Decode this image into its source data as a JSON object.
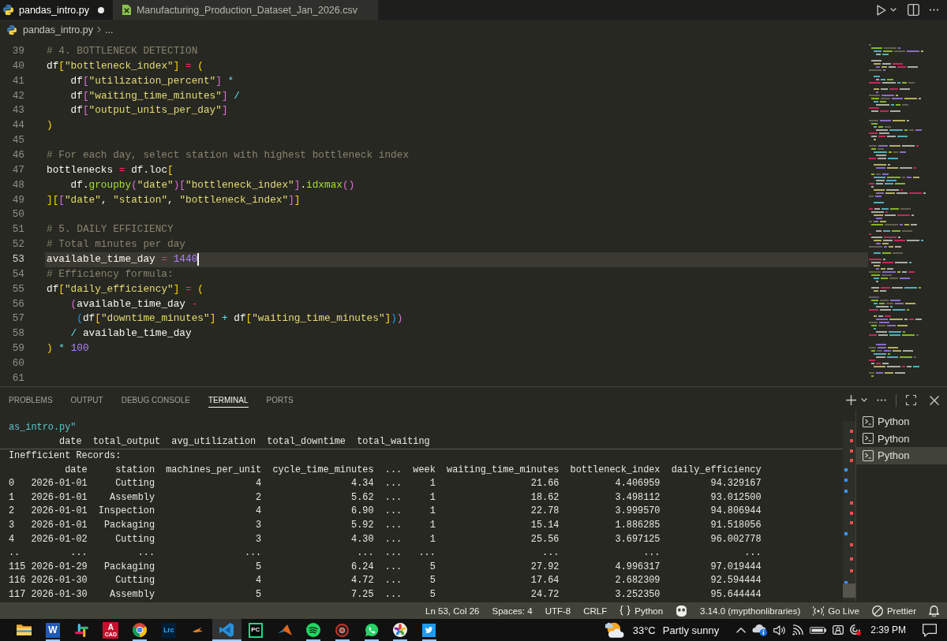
{
  "editor_tabs": [
    {
      "label": "pandas_intro.py",
      "kind": "python",
      "selected": true,
      "modified": true
    },
    {
      "label": "Manufacturing_Production_Dataset_Jan_2026.csv",
      "kind": "csv",
      "selected": false,
      "modified": false
    }
  ],
  "breadcrumb": {
    "file": "pandas_intro.py",
    "more": "..."
  },
  "code_lines": [
    {
      "number": "39",
      "active": false,
      "tokens": [
        {
          "kind": "comment",
          "text": "# 4. BOTTLENECK DETECTION"
        }
      ]
    },
    {
      "number": "40",
      "active": false,
      "tokens": [
        {
          "kind": "plain",
          "text": "df"
        },
        {
          "kind": "bracket1",
          "text": "["
        },
        {
          "kind": "string",
          "text": "\"bottleneck_index\""
        },
        {
          "kind": "bracket1",
          "text": "] "
        },
        {
          "kind": "op",
          "text": "= "
        },
        {
          "kind": "bracket1",
          "text": "("
        }
      ]
    },
    {
      "number": "41",
      "active": false,
      "tokens": [
        {
          "kind": "plain",
          "text": "    df"
        },
        {
          "kind": "bracket2",
          "text": "["
        },
        {
          "kind": "string",
          "text": "\"utilization_percent\""
        },
        {
          "kind": "bracket2",
          "text": "] "
        },
        {
          "kind": "arith",
          "text": "*"
        }
      ]
    },
    {
      "number": "42",
      "active": false,
      "tokens": [
        {
          "kind": "plain",
          "text": "    df"
        },
        {
          "kind": "bracket2",
          "text": "["
        },
        {
          "kind": "string",
          "text": "\"waiting_time_minutes\""
        },
        {
          "kind": "bracket2",
          "text": "] "
        },
        {
          "kind": "arith",
          "text": "/"
        }
      ]
    },
    {
      "number": "43",
      "active": false,
      "tokens": [
        {
          "kind": "plain",
          "text": "    df"
        },
        {
          "kind": "bracket2",
          "text": "["
        },
        {
          "kind": "string",
          "text": "\"output_units_per_day\""
        },
        {
          "kind": "bracket2",
          "text": "]"
        }
      ]
    },
    {
      "number": "44",
      "active": false,
      "tokens": [
        {
          "kind": "bracket1",
          "text": ")"
        }
      ]
    },
    {
      "number": "45",
      "active": false
    },
    {
      "number": "46",
      "active": false,
      "tokens": [
        {
          "kind": "comment",
          "text": "# For each day, select station with highest bottleneck index"
        }
      ]
    },
    {
      "number": "47",
      "active": false,
      "tokens": [
        {
          "kind": "plain",
          "text": "bottlenecks "
        },
        {
          "kind": "op",
          "text": "= "
        },
        {
          "kind": "plain",
          "text": "df.loc"
        },
        {
          "kind": "bracket1",
          "text": "["
        }
      ]
    },
    {
      "number": "48",
      "active": false,
      "tokens": [
        {
          "kind": "plain",
          "text": "    df."
        },
        {
          "kind": "func",
          "text": "groupby"
        },
        {
          "kind": "bracket2",
          "text": "("
        },
        {
          "kind": "string",
          "text": "\"date\""
        },
        {
          "kind": "bracket2",
          "text": ")["
        },
        {
          "kind": "string",
          "text": "\"bottleneck_index\""
        },
        {
          "kind": "bracket2",
          "text": "]"
        },
        {
          "kind": "plain",
          "text": "."
        },
        {
          "kind": "func",
          "text": "idxmax"
        },
        {
          "kind": "bracket2",
          "text": "()"
        }
      ]
    },
    {
      "number": "49",
      "active": false,
      "tokens": [
        {
          "kind": "bracket1",
          "text": "]["
        },
        {
          "kind": "bracket2",
          "text": "["
        },
        {
          "kind": "string",
          "text": "\"date\""
        },
        {
          "kind": "plain",
          "text": ", "
        },
        {
          "kind": "string",
          "text": "\"station\""
        },
        {
          "kind": "plain",
          "text": ", "
        },
        {
          "kind": "string",
          "text": "\"bottleneck_index\""
        },
        {
          "kind": "bracket2",
          "text": "]"
        },
        {
          "kind": "bracket1",
          "text": "]"
        }
      ]
    },
    {
      "number": "50",
      "active": false
    },
    {
      "number": "51",
      "active": false,
      "tokens": [
        {
          "kind": "comment",
          "text": "# 5. DAILY EFFICIENCY"
        }
      ]
    },
    {
      "number": "52",
      "active": false,
      "tokens": [
        {
          "kind": "comment",
          "text": "# Total minutes per day"
        }
      ]
    },
    {
      "number": "53",
      "active": true,
      "tokens": [
        {
          "kind": "plain",
          "text": "available_time_day "
        },
        {
          "kind": "op",
          "text": "= "
        },
        {
          "kind": "num",
          "text": "1440"
        }
      ]
    },
    {
      "number": "54",
      "active": false,
      "tokens": [
        {
          "kind": "comment",
          "text": "# Efficiency formula:"
        }
      ]
    },
    {
      "number": "55",
      "active": false,
      "tokens": [
        {
          "kind": "plain",
          "text": "df"
        },
        {
          "kind": "bracket1",
          "text": "["
        },
        {
          "kind": "string",
          "text": "\"daily_efficiency\""
        },
        {
          "kind": "bracket1",
          "text": "] "
        },
        {
          "kind": "op",
          "text": "= "
        },
        {
          "kind": "bracket1",
          "text": "("
        }
      ]
    },
    {
      "number": "56",
      "active": false,
      "tokens": [
        {
          "kind": "bracket2",
          "text": "    ("
        },
        {
          "kind": "plain",
          "text": "available_time_day "
        },
        {
          "kind": "op",
          "text": "-"
        }
      ]
    },
    {
      "number": "57",
      "active": false,
      "tokens": [
        {
          "kind": "bracket3",
          "text": "     ("
        },
        {
          "kind": "plain",
          "text": "df"
        },
        {
          "kind": "bracket1",
          "text": "["
        },
        {
          "kind": "string",
          "text": "\"downtime_minutes\""
        },
        {
          "kind": "bracket1",
          "text": "] "
        },
        {
          "kind": "arith",
          "text": "+ "
        },
        {
          "kind": "plain",
          "text": "df"
        },
        {
          "kind": "bracket1",
          "text": "["
        },
        {
          "kind": "string",
          "text": "\"waiting_time_minutes\""
        },
        {
          "kind": "bracket1",
          "text": "]"
        },
        {
          "kind": "bracket3",
          "text": ")"
        },
        {
          "kind": "bracket2",
          "text": ")"
        }
      ]
    },
    {
      "number": "58",
      "active": false,
      "tokens": [
        {
          "kind": "arith",
          "text": "    / "
        },
        {
          "kind": "plain",
          "text": "available_time_day"
        }
      ]
    },
    {
      "number": "59",
      "active": false,
      "tokens": [
        {
          "kind": "bracket1",
          "text": ")"
        },
        {
          "kind": "arith",
          "text": " * "
        },
        {
          "kind": "num",
          "text": "100"
        }
      ]
    },
    {
      "number": "60",
      "active": false
    },
    {
      "number": "61",
      "active": false
    }
  ],
  "panel": {
    "tabs": [
      {
        "label": "PROBLEMS",
        "selected": false
      },
      {
        "label": "OUTPUT",
        "selected": false
      },
      {
        "label": "DEBUG CONSOLE",
        "selected": false
      },
      {
        "label": "TERMINAL",
        "selected": true
      },
      {
        "label": "PORTS",
        "selected": false
      }
    ],
    "terminal": {
      "sticky": {
        "command": "as_intro.py\"",
        "columns": [
          "date",
          "total_output",
          "avg_utilization",
          "total_downtime",
          "total_waiting"
        ]
      },
      "caption": "Inefficient Records:",
      "dataframe": {
        "columns": [
          "date",
          "station",
          "machines_per_unit",
          "cycle_time_minutes",
          "...",
          "week",
          "waiting_time_minutes",
          "bottleneck_index",
          "daily_efficiency"
        ],
        "rows": [
          {
            "index": "0",
            "cells": [
              "2026-01-01",
              "Cutting",
              "4",
              "4.34",
              "...",
              "1",
              "21.66",
              "4.406959",
              "94.329167"
            ]
          },
          {
            "index": "1",
            "cells": [
              "2026-01-01",
              "Assembly",
              "2",
              "5.62",
              "...",
              "1",
              "18.62",
              "3.498112",
              "93.012500"
            ]
          },
          {
            "index": "2",
            "cells": [
              "2026-01-01",
              "Inspection",
              "4",
              "6.90",
              "...",
              "1",
              "22.78",
              "3.999570",
              "94.806944"
            ]
          },
          {
            "index": "3",
            "cells": [
              "2026-01-01",
              "Packaging",
              "3",
              "5.92",
              "...",
              "1",
              "15.14",
              "1.886285",
              "91.518056"
            ]
          },
          {
            "index": "4",
            "cells": [
              "2026-01-02",
              "Cutting",
              "3",
              "4.30",
              "...",
              "1",
              "25.56",
              "3.697125",
              "96.002778"
            ]
          },
          {
            "index": "..",
            "cells": [
              "...",
              "...",
              "...",
              "...",
              "...",
              "...",
              "...",
              "...",
              "..."
            ]
          },
          {
            "index": "115",
            "cells": [
              "2026-01-29",
              "Packaging",
              "5",
              "6.24",
              "...",
              "5",
              "27.92",
              "4.996317",
              "97.019444"
            ]
          },
          {
            "index": "116",
            "cells": [
              "2026-01-30",
              "Cutting",
              "4",
              "4.72",
              "...",
              "5",
              "17.64",
              "2.682309",
              "92.594444"
            ]
          },
          {
            "index": "117",
            "cells": [
              "2026-01-30",
              "Assembly",
              "5",
              "7.25",
              "...",
              "5",
              "24.72",
              "3.252350",
              "95.644444"
            ]
          }
        ]
      }
    },
    "terminals": [
      {
        "label": "Python",
        "selected": false
      },
      {
        "label": "Python",
        "selected": false
      },
      {
        "label": "Python",
        "selected": true
      }
    ]
  },
  "status_bar": {
    "position": "Ln 53, Col 26",
    "indentation": "Spaces: 4",
    "encoding": "UTF-8",
    "line_ending": "CRLF",
    "language": "Python",
    "interpreter": "3.14.0 (mypthonlibraries)",
    "live_server": "Go Live",
    "formatter": "Prettier"
  },
  "taskbar": {
    "apps": [
      {
        "kind": "folder",
        "running": false,
        "active": false
      },
      {
        "kind": "word",
        "label": "W",
        "running": true,
        "active": false
      },
      {
        "kind": "slack",
        "running": false,
        "active": false
      },
      {
        "kind": "cad",
        "label": "A",
        "sublabel": "CAD",
        "running": false,
        "active": false
      },
      {
        "kind": "chrome",
        "running": true,
        "active": false
      },
      {
        "kind": "lightroom",
        "label": "Lrc",
        "running": false,
        "active": false
      },
      {
        "kind": "arrow",
        "running": false,
        "active": false
      },
      {
        "kind": "vscode",
        "running": true,
        "active": true
      },
      {
        "kind": "pycharm",
        "label": "PC",
        "running": false,
        "active": false
      },
      {
        "kind": "matlab",
        "running": false,
        "active": false
      },
      {
        "kind": "spotify",
        "running": true,
        "active": false
      },
      {
        "kind": "record",
        "running": true,
        "active": false
      },
      {
        "kind": "whatsapp",
        "running": true,
        "active": false
      },
      {
        "kind": "pinwheel",
        "running": true,
        "active": false
      },
      {
        "kind": "twitter",
        "running": true,
        "active": false
      }
    ],
    "weather": {
      "temperature": "33°C",
      "condition": "Partly sunny"
    },
    "clock": "2:39 PM"
  }
}
